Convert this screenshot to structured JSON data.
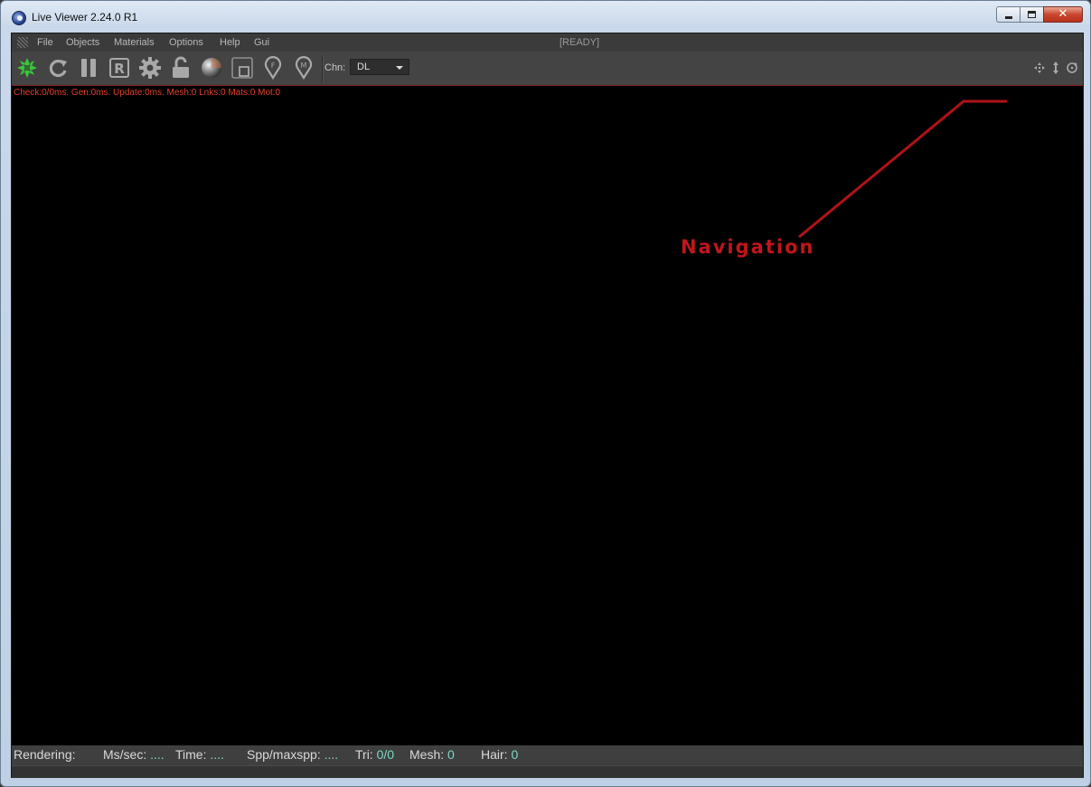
{
  "window": {
    "title": "Live Viewer 2.24.0 R1",
    "close_glyph": "✕"
  },
  "menu": {
    "items": [
      "File",
      "Objects",
      "Materials",
      "Options",
      "Help",
      "Gui"
    ],
    "status": "[READY]"
  },
  "toolbar": {
    "icons": [
      "octane-logo-icon",
      "refresh-icon",
      "pause-icon",
      "r-box-icon",
      "gear-icon",
      "unlock-icon",
      "sphere-icon",
      "region-icon",
      "focus-pin-icon",
      "material-pin-icon"
    ],
    "channel_label": "Chn:",
    "channel_value": "DL",
    "nav_icons": [
      "move-icon",
      "dolly-icon",
      "orbit-icon"
    ]
  },
  "viewport": {
    "stats": "Check:0/0ms. Gen:0ms. Update:0ms. Mesh:0 Lnks:0 Mats:0 Mot:0",
    "annotation": "Navigation"
  },
  "statusbar": {
    "rendering_label": "Rendering:",
    "ms_label": "Ms/sec:",
    "ms_value": "....",
    "time_label": "Time:",
    "time_value": "....",
    "spp_label": "Spp/maxspp:",
    "spp_value": "....",
    "tri_label": "Tri:",
    "tri_value": "0/0",
    "mesh_label": "Mesh:",
    "mesh_value": "0",
    "hair_label": "Hair:",
    "hair_value": "0"
  },
  "colors": {
    "accent_red": "#c0151c",
    "stats_red": "#e0412b",
    "value_teal": "#7dd9c4",
    "logo_green": "#3cc43c"
  }
}
